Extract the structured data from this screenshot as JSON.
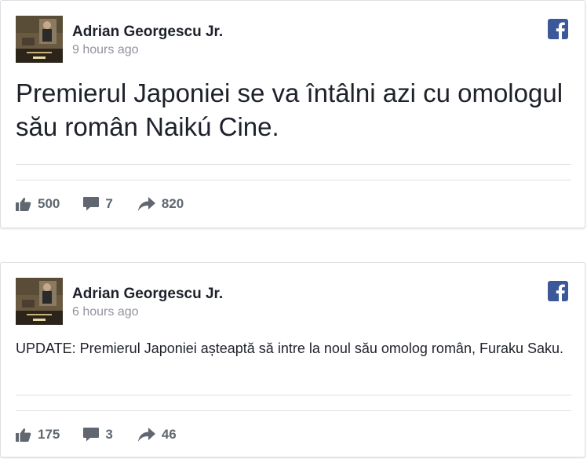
{
  "posts": [
    {
      "author": "Adrian Georgescu Jr.",
      "time": "9 hours ago",
      "message": "Premierul Japoniei se va întâlni azi cu omologul său român Naikú Cine.",
      "likes": "500",
      "comments": "7",
      "shares": "820"
    },
    {
      "author": "Adrian Georgescu Jr.",
      "time": "6 hours ago",
      "message": "UPDATE: Premierul Japoniei așteaptă să intre la noul său omolog român, Furaku Saku.",
      "likes": "175",
      "comments": "3",
      "shares": "46"
    }
  ],
  "icons": {
    "brand": "facebook-icon",
    "like": "thumbs-up-icon",
    "comment": "speech-bubble-icon",
    "share": "share-arrow-icon"
  },
  "colors": {
    "facebook_blue": "#3b5998",
    "icon_gray": "#606770",
    "timestamp_gray": "#90949c",
    "border": "#dddfe2"
  }
}
